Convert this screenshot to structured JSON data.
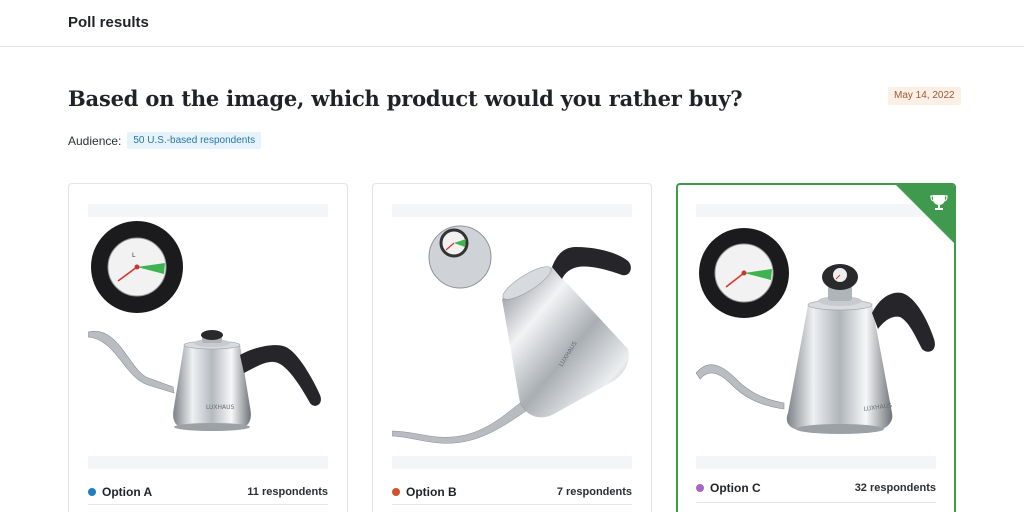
{
  "header": {
    "title": "Poll results"
  },
  "poll": {
    "question": "Based on the image, which product would you rather buy?",
    "date": "May 14, 2022",
    "audience_label": "Audience:",
    "audience_value": "50 U.S.-based respondents"
  },
  "options": [
    {
      "label": "Option A",
      "respondents": "11 respondents",
      "dot_color": "#1f7fc1",
      "brand": "LUXHAUS"
    },
    {
      "label": "Option B",
      "respondents": "7 respondents",
      "dot_color": "#d0532b",
      "brand": "LUXHAUS"
    },
    {
      "label": "Option C",
      "respondents": "32 respondents",
      "dot_color": "#a668c8",
      "brand": "LUXHAUS"
    }
  ],
  "winner": {
    "option_index": 2,
    "icon": "trophy-icon",
    "accent": "#3f9a4d"
  }
}
